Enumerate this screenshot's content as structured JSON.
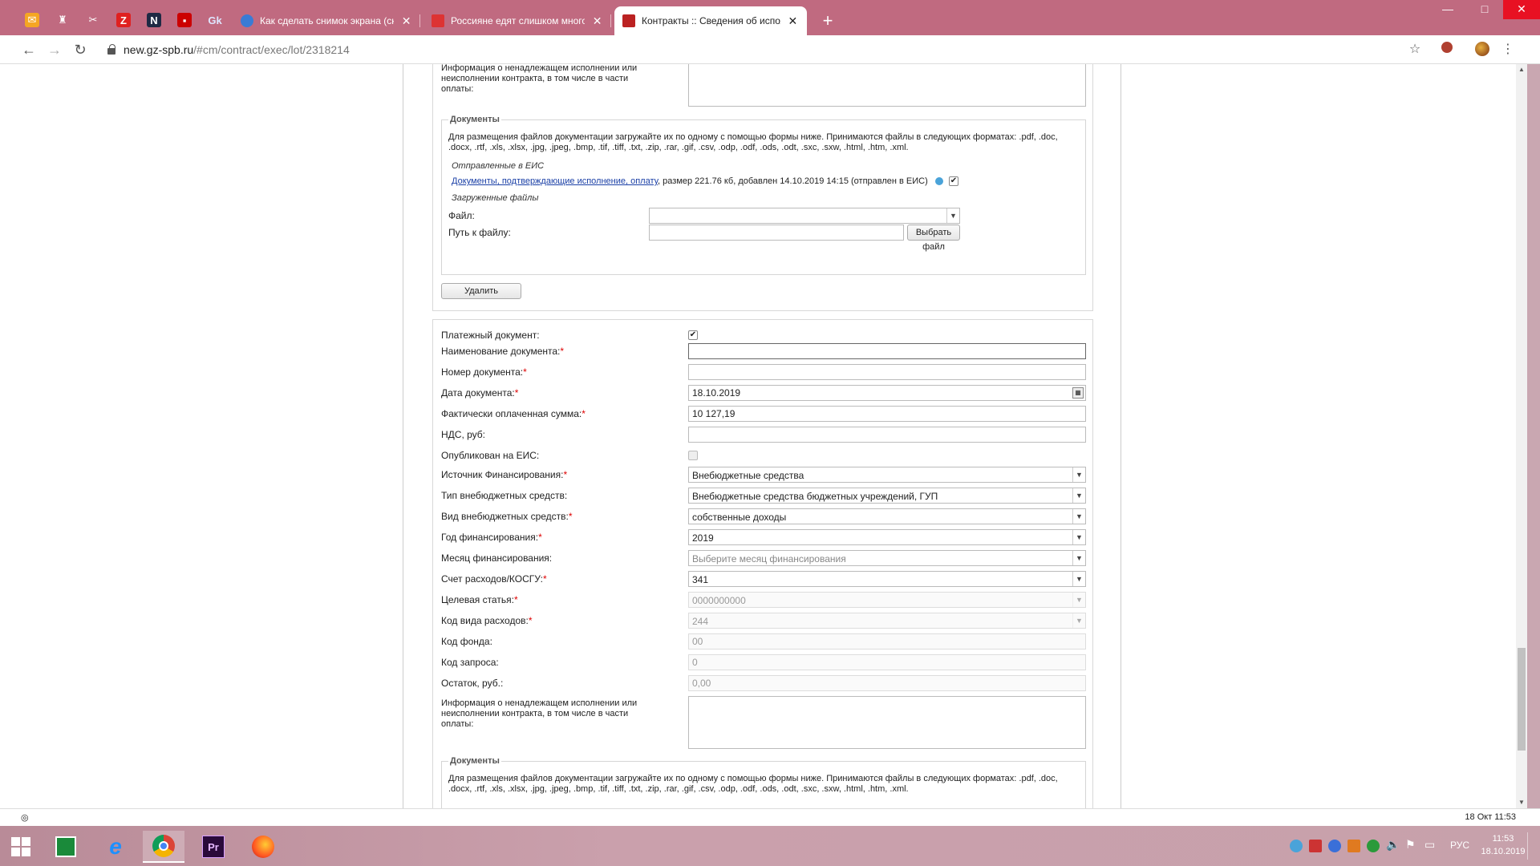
{
  "browser": {
    "tabs": [
      {
        "title": "Как сделать снимок экрана (скр",
        "active": false
      },
      {
        "title": "Россияне едят слишком много",
        "active": false
      },
      {
        "title": "Контракты :: Сведения об испол",
        "active": true
      }
    ],
    "url_host": "new.gz-spb.ru",
    "url_path": "/#cm/contract/exec/lot/2318214",
    "status_left": "",
    "status_right": "18 Окт 11:53"
  },
  "upper_section": {
    "info_label": "Информация о ненадлежащем исполнении или неисполнении контракта, в том числе в части оплаты:",
    "documents": {
      "legend": "Документы",
      "instructions": "Для размещения файлов документации загружайте их по одному с помощью формы ниже. Принимаются файлы в следующих форматах: .pdf, .doc, .docx, .rtf, .xls, .xlsx, .jpg, .jpeg, .bmp, .tif, .tiff, .txt, .zip, .rar, .gif, .csv, .odp, .odf, .ods, .odt, .sxc, .sxw, .html, .htm, .xml.",
      "sent_heading": "Отправленные в ЕИС",
      "sent_file_link": "Документы, подтверждающие исполнение, оплату",
      "sent_file_meta": ", размер 221.76 кб, добавлен 14.10.2019 14:15 (отправлен в ЕИС)",
      "uploaded_heading": "Загруженные файлы",
      "file_label": "Файл:",
      "path_label": "Путь к файлу:",
      "choose_file_button": "Выбрать файл"
    },
    "delete_button": "Удалить"
  },
  "form": {
    "payment_doc_label": "Платежный документ:",
    "payment_doc_checked": true,
    "doc_name_label": "Наименование документа:",
    "doc_name_value": "",
    "doc_number_label": "Номер документа:",
    "doc_number_value": "",
    "doc_date_label": "Дата документа:",
    "doc_date_value": "18.10.2019",
    "paid_sum_label": "Фактически оплаченная сумма:",
    "paid_sum_value": "10 127,19",
    "vat_label": "НДС, руб:",
    "vat_value": "",
    "published_label": "Опубликован на ЕИС:",
    "published_checked": false,
    "funding_source_label": "Источник Финансирования:",
    "funding_source_value": "Внебюджетные средства",
    "extrabudget_type_label": "Тип внебюджетных средств:",
    "extrabudget_type_value": "Внебюджетные средства бюджетных учреждений, ГУП",
    "extrabudget_kind_label": "Вид внебюджетных средств:",
    "extrabudget_kind_value": "собственные доходы",
    "funding_year_label": "Год финансирования:",
    "funding_year_value": "2019",
    "funding_month_label": "Месяц финансирования:",
    "funding_month_placeholder": "Выберите месяц финансирования",
    "expense_account_label": "Счет расходов/КОСГУ:",
    "expense_account_value": "341",
    "target_item_label": "Целевая статья:",
    "target_item_value": "0000000000",
    "expense_type_label": "Код вида расходов:",
    "expense_type_value": "244",
    "fund_code_label": "Код фонда:",
    "fund_code_value": "00",
    "request_code_label": "Код запроса:",
    "request_code_value": "0",
    "balance_label": "Остаток, руб.:",
    "balance_value": "0,00",
    "info_label": "Информация о ненадлежащем исполнении или неисполнении контракта, в том числе в части оплаты:"
  },
  "lower_documents": {
    "legend": "Документы",
    "instructions": "Для размещения файлов документации загружайте их по одному с помощью формы ниже. Принимаются файлы в следующих форматах: .pdf, .doc, .docx, .rtf, .xls, .xlsx, .jpg, .jpeg, .bmp, .tif, .tiff, .txt, .zip, .rar, .gif, .csv, .odp, .odf, .ods, .odt, .sxc, .sxw, .html, .htm, .xml."
  },
  "taskbar": {
    "language": "РУС",
    "time": "11:53",
    "date": "18.10.2019"
  }
}
